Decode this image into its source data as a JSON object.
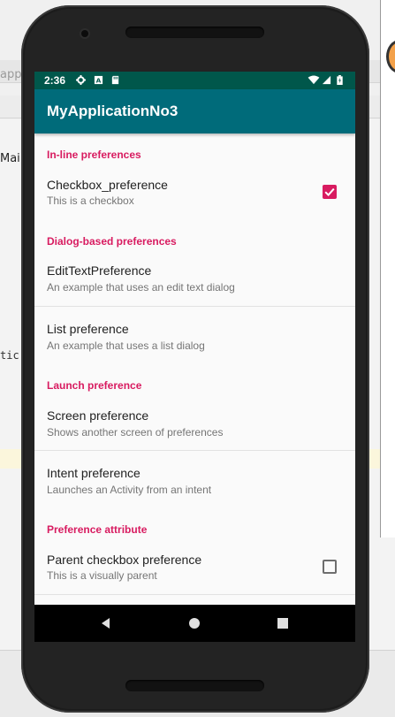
{
  "ide_background": {
    "left_text_top": "app",
    "left_text_mid": "Mai",
    "left_text_code": "tic"
  },
  "status_bar": {
    "time": "2:36",
    "icons": [
      "settings-icon",
      "sim-a-icon",
      "sd-card-icon",
      "wifi-icon",
      "signal-icon",
      "battery-icon"
    ]
  },
  "app_bar": {
    "title": "MyApplicationNo3",
    "color": "#006b7a",
    "status_color": "#00574b"
  },
  "accent_color": "#d81b60",
  "preferences": {
    "inline_header": "In-line preferences",
    "checkbox_pref": {
      "title": "Checkbox_preference",
      "summary": "This is a checkbox",
      "checked": true
    },
    "dialog_header": "Dialog-based preferences",
    "edittext_pref": {
      "title": "EditTextPreference",
      "summary": "An example that uses an edit text dialog"
    },
    "list_pref": {
      "title": "List preference",
      "summary": "An example that uses a list dialog"
    },
    "launch_header": "Launch preference",
    "screen_pref": {
      "title": "Screen preference",
      "summary": "Shows another screen of preferences"
    },
    "intent_pref": {
      "title": "Intent preference",
      "summary": "Launches an Activity from an intent"
    },
    "attribute_header": "Preference attribute",
    "parent_pref": {
      "title": "Parent checkbox preference",
      "summary": "This is a visually parent",
      "checked": false
    }
  },
  "nav_bar": {
    "buttons": [
      "back-icon",
      "home-icon",
      "recents-icon"
    ]
  }
}
